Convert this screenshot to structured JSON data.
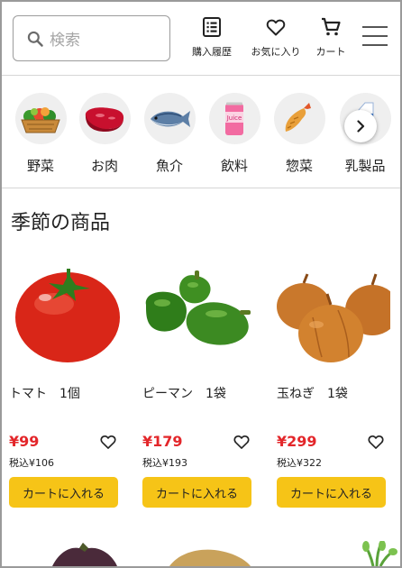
{
  "header": {
    "search_placeholder": "検索",
    "nav": [
      {
        "label": "購入履歴",
        "icon": "list-icon"
      },
      {
        "label": "お気に入り",
        "icon": "heart-icon"
      },
      {
        "label": "カート",
        "icon": "cart-icon"
      }
    ],
    "menu_icon": "hamburger-menu-icon"
  },
  "categories": [
    {
      "label": "野菜",
      "icon": "vegetable-basket-icon"
    },
    {
      "label": "お肉",
      "icon": "meat-icon"
    },
    {
      "label": "魚介",
      "icon": "fish-icon"
    },
    {
      "label": "飲料",
      "icon": "juice-can-icon"
    },
    {
      "label": "惣菜",
      "icon": "fried-shrimp-icon"
    },
    {
      "label": "乳製品",
      "icon": "milk-carton-icon"
    }
  ],
  "can_text": "Juice",
  "section": {
    "title": "季節の商品"
  },
  "products": [
    {
      "name": "トマト　1個",
      "price": "¥99",
      "tax_price": "税込¥106",
      "button": "カートに入れる",
      "image": "tomato"
    },
    {
      "name": "ピーマン　1袋",
      "price": "¥179",
      "tax_price": "税込¥193",
      "button": "カートに入れる",
      "image": "green-pepper"
    },
    {
      "name": "玉ねぎ　1袋",
      "price": "¥299",
      "tax_price": "税込¥322",
      "button": "カートに入れる",
      "image": "onion"
    }
  ],
  "colors": {
    "price": "#e3262a",
    "button": "#f6c417",
    "divider": "#d6d6d6",
    "category_bg": "#efefef"
  }
}
